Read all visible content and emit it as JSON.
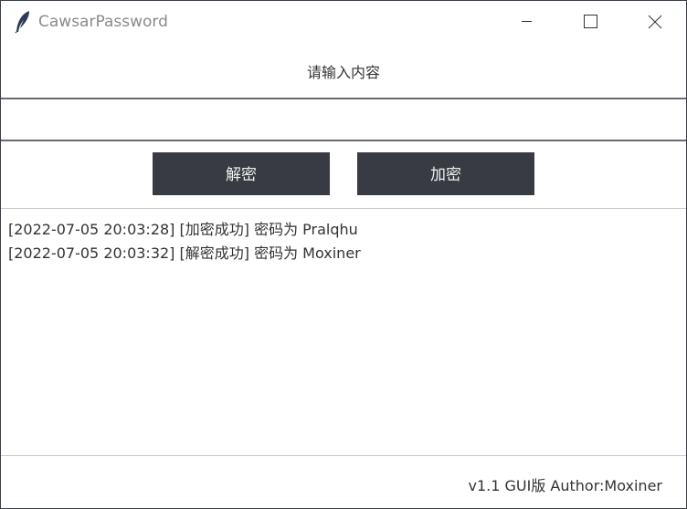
{
  "window": {
    "title": "CawsarPassword",
    "controls": [
      "minimize-icon",
      "maximize-icon",
      "close-icon"
    ],
    "app_icon": "feather-icon"
  },
  "form": {
    "prompt": "请输入内容",
    "input_value": "",
    "decrypt_label": "解密",
    "encrypt_label": "加密"
  },
  "log": [
    "[2022-07-05 20:03:28] [加密成功] 密码为 Pralqhu",
    "[2022-07-05 20:03:32] [解密成功] 密码为 Moxiner"
  ],
  "status": {
    "text": "v1.1 GUI版 Author:Moxiner"
  },
  "colors": {
    "button_bg": "#383c42",
    "button_text": "#f0f0f0",
    "title_text": "#8a8a8a"
  }
}
